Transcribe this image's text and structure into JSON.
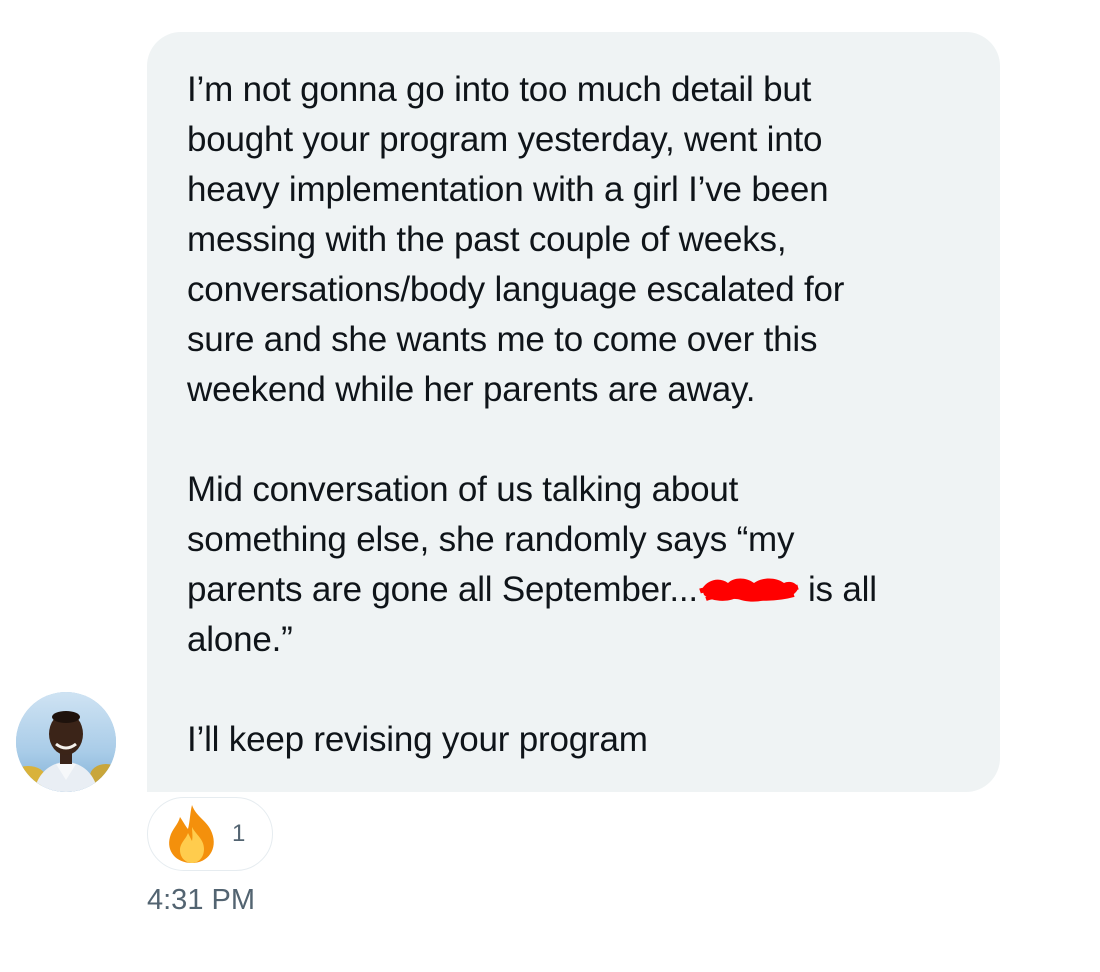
{
  "message": {
    "paragraph_1": {
      "line_1": "I’m not gonna go into too much detail but",
      "line_2": "bought your program yesterday, went into",
      "line_3": "heavy implementation with a girl I’ve been",
      "line_4": "messing with the past couple of weeks,",
      "line_5": "conversations/body language escalated for",
      "line_6": "sure and she wants me to come over this",
      "line_7": "weekend while her parents are away."
    },
    "paragraph_2": {
      "line_1": "Mid conversation of us talking about",
      "line_2": "something else, she randomly says “my",
      "line_3_before_redaction": "parents are gone all September...",
      "line_3_after_redaction": "is all",
      "line_4": "alone.”"
    },
    "paragraph_3": {
      "line_1": "I’ll keep revising your program"
    },
    "redaction_color": "#ff0000",
    "bubble_color": "#eff3f4",
    "text_color": "#0f1419"
  },
  "reaction": {
    "emoji_icon": "fire-icon",
    "count": "1"
  },
  "timestamp": "4:31 PM",
  "avatar": {
    "icon": "user-avatar"
  }
}
